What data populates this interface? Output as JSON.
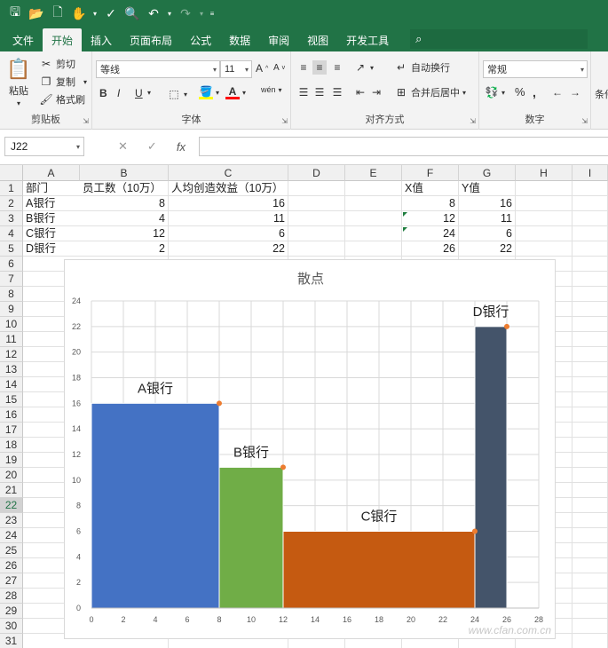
{
  "qat": {
    "icons": [
      "save-icon",
      "open-icon",
      "new-icon",
      "touch-icon",
      "spell-icon",
      "preview-icon",
      "undo-icon",
      "redo-icon",
      "customize-icon"
    ]
  },
  "tabs": [
    "文件",
    "开始",
    "插入",
    "页面布局",
    "公式",
    "数据",
    "审阅",
    "视图",
    "开发工具"
  ],
  "active_tab": "开始",
  "ribbon": {
    "clipboard": {
      "label": "剪贴板",
      "paste": "粘贴",
      "cut": "剪切",
      "copy": "复制",
      "format_painter": "格式刷"
    },
    "font": {
      "label": "字体",
      "font_name": "等线",
      "font_size": "11",
      "bold": "B",
      "italic": "I",
      "underline": "U",
      "phonetic": "wén"
    },
    "alignment": {
      "label": "对齐方式",
      "wrap": "自动换行",
      "merge": "合并后居中"
    },
    "number": {
      "label": "数字",
      "format": "常规",
      "percent": "%",
      "comma": ","
    },
    "styles_partial": "条件"
  },
  "formula_bar": {
    "name_box": "J22",
    "fx": "fx",
    "formula": ""
  },
  "columns": [
    "A",
    "B",
    "C",
    "D",
    "E",
    "F",
    "G",
    "H",
    "I"
  ],
  "rows": [
    "1",
    "2",
    "3",
    "4",
    "5",
    "6",
    "7",
    "8",
    "9",
    "10",
    "11",
    "12",
    "13",
    "14",
    "15",
    "16",
    "17",
    "18",
    "19",
    "20",
    "21",
    "22",
    "23",
    "24",
    "25",
    "26",
    "27",
    "28",
    "29",
    "30",
    "31"
  ],
  "active_row": "22",
  "cells": {
    "A1": "部门",
    "B1": "员工数（10万）",
    "C1": "人均创造效益（10万）",
    "F1": "X值",
    "G1": "Y值",
    "A2": "A银行",
    "B2": "8",
    "C2": "16",
    "F2": "8",
    "G2": "16",
    "A3": "B银行",
    "B3": "4",
    "C3": "11",
    "F3": "12",
    "G3": "11",
    "A4": "C银行",
    "B4": "12",
    "C4": "6",
    "F4": "24",
    "G4": "6",
    "A5": "D银行",
    "B5": "2",
    "C5": "22",
    "F5": "26",
    "G5": "22"
  },
  "chart_data": {
    "type": "scatter",
    "title": "散点",
    "xlim": [
      0,
      28
    ],
    "ylim": [
      0,
      24
    ],
    "xticks": [
      0,
      2,
      4,
      6,
      8,
      10,
      12,
      14,
      16,
      18,
      20,
      22,
      24,
      26,
      28
    ],
    "yticks": [
      0,
      2,
      4,
      6,
      8,
      10,
      12,
      14,
      16,
      18,
      20,
      22,
      24
    ],
    "grid": true,
    "points": [
      {
        "x": 8,
        "y": 16
      },
      {
        "x": 12,
        "y": 11
      },
      {
        "x": 24,
        "y": 6
      },
      {
        "x": 26,
        "y": 22
      }
    ],
    "blocks": [
      {
        "label": "A银行",
        "x0": 0,
        "x1": 8,
        "height": 16,
        "color": "#4472c4"
      },
      {
        "label": "B银行",
        "x0": 8,
        "x1": 12,
        "height": 11,
        "color": "#70ad47"
      },
      {
        "label": "C银行",
        "x0": 12,
        "x1": 24,
        "height": 6,
        "color": "#c55a11"
      },
      {
        "label": "D银行",
        "x0": 24,
        "x1": 26,
        "height": 22,
        "color": "#44546a"
      }
    ],
    "point_color": "#ed7d31"
  },
  "watermark": "www.cfan.com.cn"
}
